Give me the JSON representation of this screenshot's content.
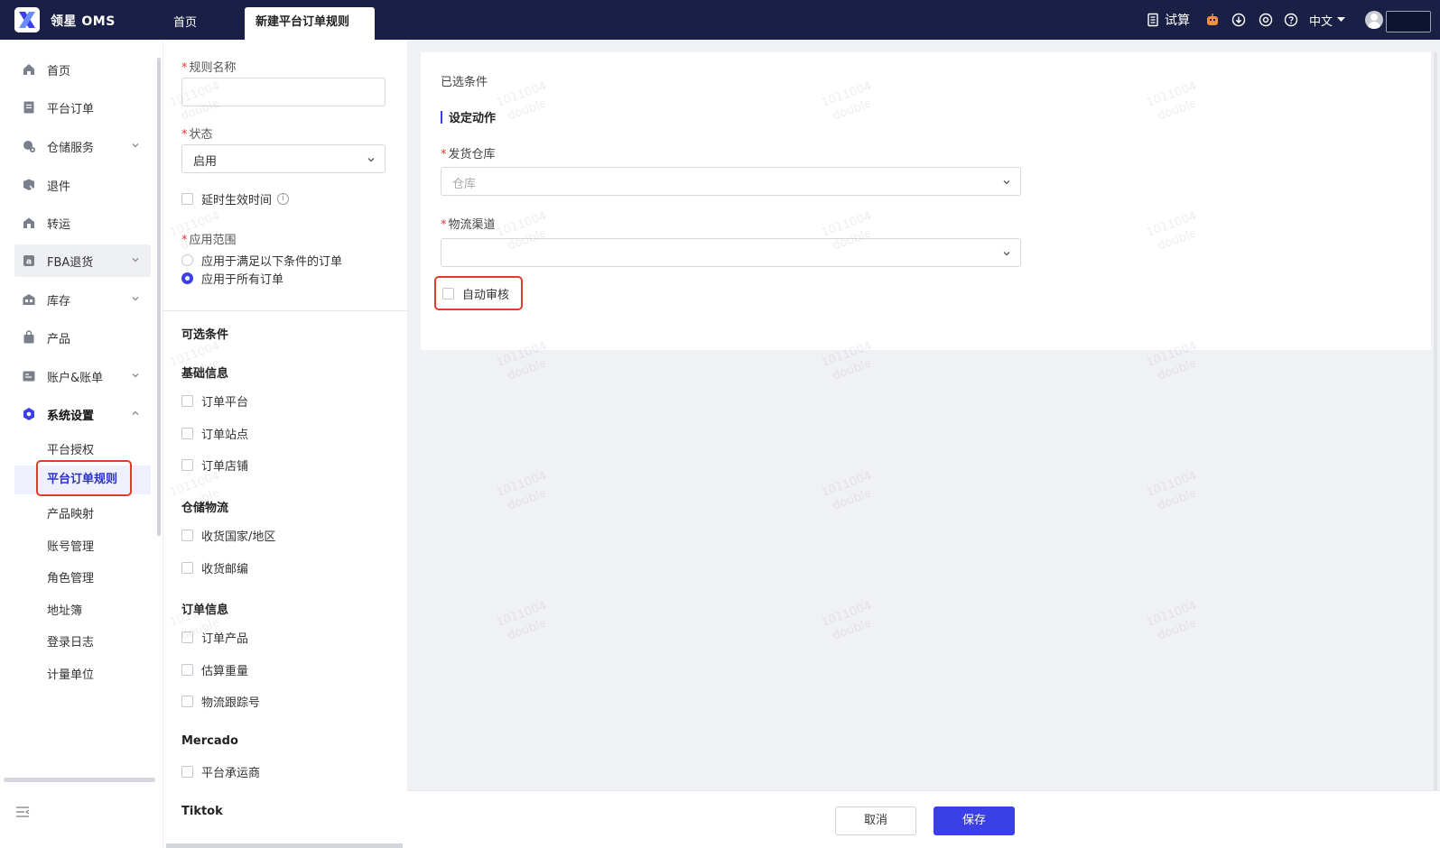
{
  "app": {
    "brand": "领星 OMS"
  },
  "tabs": [
    {
      "label": "首页"
    },
    {
      "label": "新建平台订单规则"
    }
  ],
  "topbar": {
    "calc_label": "试算",
    "language": "中文"
  },
  "sidebar": {
    "items": [
      {
        "label": "首页",
        "icon": "home-icon"
      },
      {
        "label": "平台订单",
        "icon": "clipboard-icon"
      },
      {
        "label": "仓储服务",
        "icon": "warehouse-service-icon"
      },
      {
        "label": "退件",
        "icon": "return-icon"
      },
      {
        "label": "转运",
        "icon": "transfer-icon"
      },
      {
        "label": "FBA退货",
        "icon": "amazon-icon"
      },
      {
        "label": "库存",
        "icon": "inventory-icon"
      },
      {
        "label": "产品",
        "icon": "bag-icon"
      },
      {
        "label": "账户&账单",
        "icon": "account-icon"
      },
      {
        "label": "系统设置",
        "icon": "settings-hex-icon"
      }
    ],
    "sub_items": [
      "平台授权",
      "平台订单规则",
      "产品映射",
      "账号管理",
      "角色管理",
      "地址簿",
      "登录日志",
      "计量单位"
    ]
  },
  "form": {
    "rule_name_label": "规则名称",
    "rule_name_value": "",
    "status_label": "状态",
    "status_value": "启用",
    "delay_label": "延时生效时间",
    "scope_label": "应用范围",
    "scope_options": [
      "应用于满足以下条件的订单",
      "应用于所有订单"
    ],
    "scope_selected": 1
  },
  "conditions": {
    "title": "可选条件",
    "groups": [
      {
        "title": "基础信息",
        "items": [
          "订单平台",
          "订单站点",
          "订单店铺"
        ]
      },
      {
        "title": "仓储物流",
        "items": [
          "收货国家/地区",
          "收货邮编"
        ]
      },
      {
        "title": "订单信息",
        "items": [
          "订单产品",
          "估算重量",
          "物流跟踪号"
        ]
      },
      {
        "title": "Mercado",
        "items": [
          "平台承运商"
        ]
      },
      {
        "title": "Tiktok",
        "items": []
      }
    ]
  },
  "content": {
    "selected_conditions_label": "已选条件",
    "action_section_title": "设定动作",
    "warehouse_label": "发货仓库",
    "warehouse_placeholder": "仓库",
    "channel_label": "物流渠道",
    "channel_value": "",
    "auto_review_label": "自动审核"
  },
  "footer": {
    "cancel_label": "取消",
    "save_label": "保存"
  },
  "watermark": {
    "line1": "1011004",
    "line2": "double"
  },
  "colors": {
    "topbar": "#1a2045",
    "accent": "#3a3fe8",
    "highlight": "#e03b2c"
  }
}
